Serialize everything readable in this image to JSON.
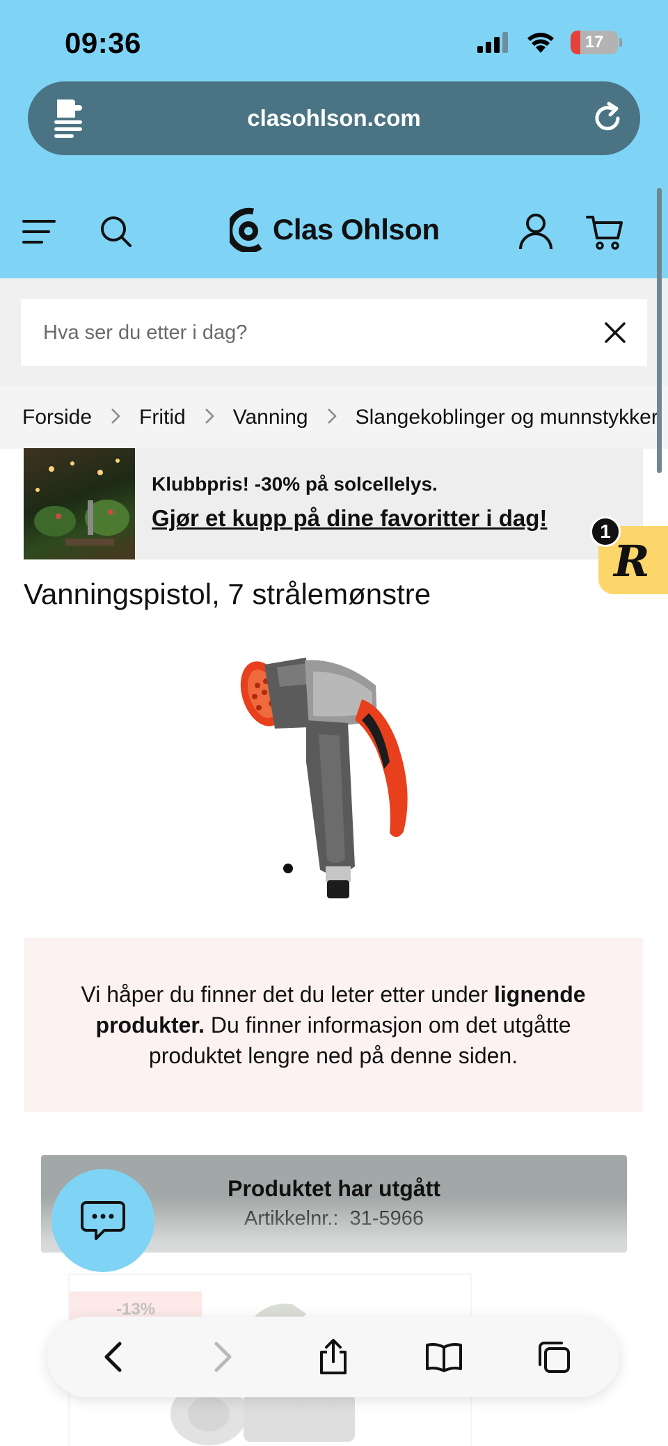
{
  "status_bar": {
    "time": "09:36",
    "battery": "17",
    "icons": [
      "signal-icon",
      "wifi-icon",
      "battery-icon"
    ]
  },
  "browser": {
    "url": "clasohlson.com",
    "left_icon": "reader-icon",
    "right_icon": "reload-icon"
  },
  "header": {
    "logo_text": "Clas Ohlson",
    "icons": [
      "menu-icon",
      "search-icon",
      "account-icon",
      "cart-icon"
    ]
  },
  "search": {
    "placeholder": "Hva ser du etter i dag?"
  },
  "breadcrumb": {
    "items": [
      "Forside",
      "Fritid",
      "Vanning",
      "Slangekoblinger og munnstykker"
    ]
  },
  "promo": {
    "line1": "Klubbpris! -30% på solcellelys.",
    "line2": "Gjør et kupp på dine favoritter i dag!"
  },
  "reward_badge": {
    "letter": "R",
    "count": "1"
  },
  "product": {
    "title": "Vanningspistol, 7 strålemønstre"
  },
  "notice": {
    "text_before": "Vi håper du finner det du leter etter under ",
    "bold": "lignende produkter.",
    "text_after": " Du finner informasjon om det utgåtte produktet lengre ned på denne siden."
  },
  "discontinued": {
    "title": "Produktet har utgått",
    "sku_label": "Artikkelnr.:",
    "sku": "31-5966"
  },
  "related_card": {
    "discount": "-13%"
  },
  "toolbar": {
    "buttons": [
      "back-icon",
      "forward-icon",
      "share-icon",
      "bookmarks-icon",
      "tabs-icon"
    ]
  },
  "colors": {
    "brand_blue": "#7fd4f6",
    "url_bar": "#4a7383",
    "notice_bg": "#fdf2f2",
    "discontinued_bg": "#a2a8a7",
    "sale_badge": "#f4a9a5",
    "reward_badge": "#fcd66a"
  }
}
